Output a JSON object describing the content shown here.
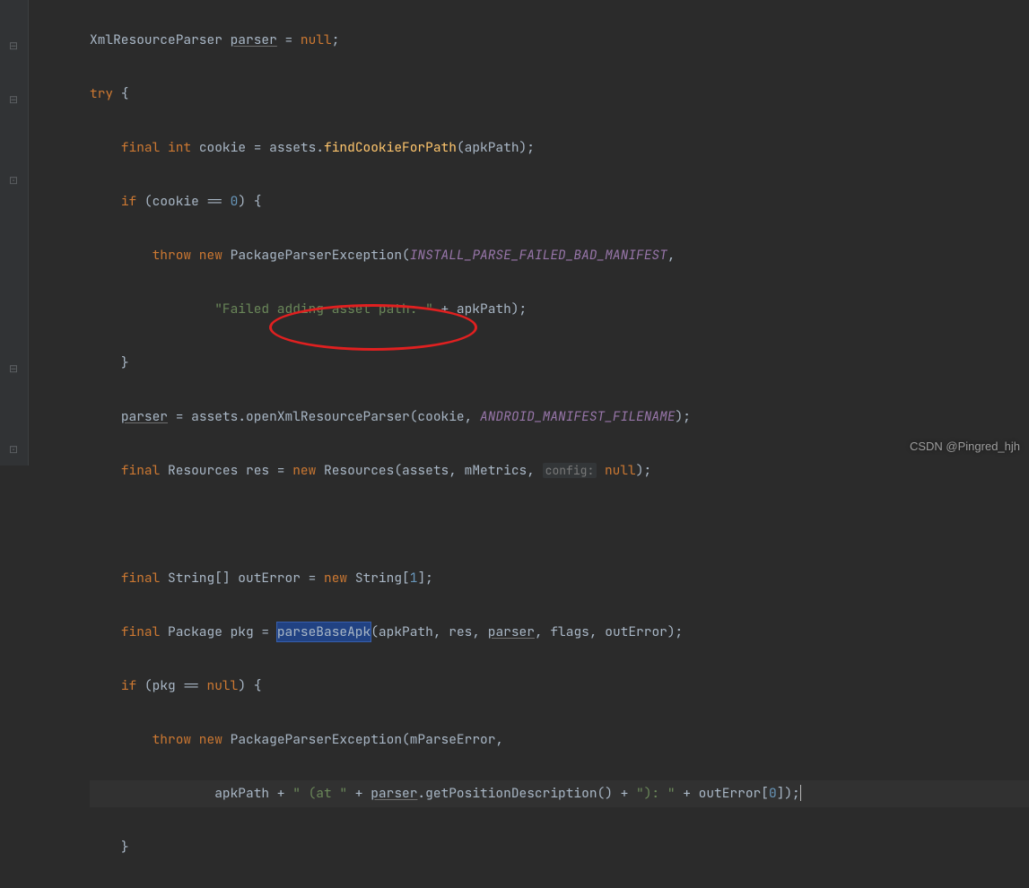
{
  "code": {
    "l1": {
      "t1": "XmlResourceParser ",
      "t2": "parser",
      "t3": " = ",
      "t4": "null",
      "t5": ";"
    },
    "l2": {
      "t1": "try",
      "t2": " {"
    },
    "l3": {
      "t1": "final int",
      "t2": " cookie = assets.",
      "t3": "findCookieForPath",
      "t4": "(apkPath);"
    },
    "l4": {
      "t1": "if",
      "t2": " (cookie == ",
      "t3": "0",
      "t4": ") {"
    },
    "l5": {
      "t1": "throw new",
      "t2": " PackageParserException(",
      "t3": "INSTALL_PARSE_FAILED_BAD_MANIFEST",
      "t4": ","
    },
    "l6": {
      "t1": "\"Failed adding asset path: \"",
      "t2": " + apkPath);"
    },
    "l7": {
      "t1": "}"
    },
    "l8": {
      "t1": "parser",
      "t2": " = assets.openXmlResourceParser(cookie, ",
      "t3": "ANDROID_MANIFEST_FILENAME",
      "t4": ");"
    },
    "l9": {
      "t1": "final",
      "t2": " Resources res = ",
      "t3": "new",
      "t4": " Resources(assets, mMetrics, ",
      "t5": "config:",
      "t6": " null",
      "t7": ");"
    },
    "l10": {
      "t1": ""
    },
    "l11": {
      "t1": "final",
      "t2": " String[] outError = ",
      "t3": "new",
      "t4": " String[",
      "t5": "1",
      "t6": "];"
    },
    "l12": {
      "t1": "final",
      "t2": " Package pkg = ",
      "t3": "parseBaseApk",
      "t4": "(apk",
      "t4b": "Path",
      "t5": ", res, ",
      "t6": "parser",
      "t7": ", flags, outError);"
    },
    "l13": {
      "t1": "if",
      "t2": " (pkg == ",
      "t3": "null",
      "t4": ") {"
    },
    "l14": {
      "t1": "throw new",
      "t2": " PackageParserException(mParseError,"
    },
    "l15": {
      "t1": "apkPath + ",
      "t2": "\" (at \"",
      "t3": " + ",
      "t4": "parser",
      "t5": ".getPositionDescription() + ",
      "t6": "\"): \"",
      "t7": " + outError[",
      "t8": "0",
      "t9": "]);"
    },
    "l16": {
      "t1": "}"
    }
  },
  "highlight": "parseBase",
  "watermark": "CSDN @Pingred_hjh"
}
